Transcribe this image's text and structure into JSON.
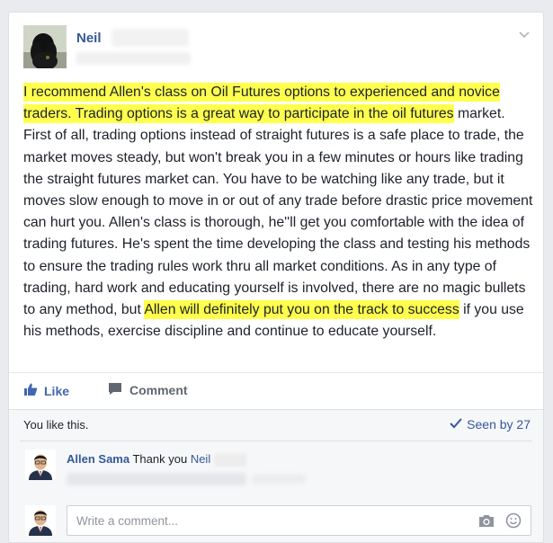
{
  "post": {
    "author_first": "Neil",
    "text_before": "I recommend Allen's class on Oil Futures options to experienced and novice traders. Trading options is a great way to participate in the oil futures",
    "text_middle": " market. First of all, trading options instead of straight futures is a safe place to trade, the market moves steady, but won't break you in a few minutes or hours like trading the straight futures market can. You have to be watching like any trade, but it moves slow enough to move in or out of any trade before drastic price movement can hurt you. Allen's class is thorough, he''ll get you comfortable with the idea of trading futures. He's spent the time developing the class and testing his methods to ensure the trading rules work thru all market conditions. As in any type of trading, hard work and educating yourself is involved, there are no magic bullets to any method, but ",
    "text_highlight2": "Allen will definitely put you on the track to success",
    "text_after": " if you use his methods, exercise discipline and continue to educate yourself."
  },
  "actions": {
    "like_label": "Like",
    "comment_label": "Comment"
  },
  "feedback": {
    "likes_text": "You like this.",
    "seen_by": "Seen by 27"
  },
  "comments": [
    {
      "author": "Allen Sama",
      "text": "Thank you",
      "mention": "Neil"
    }
  ],
  "comment_box": {
    "placeholder": "Write a comment..."
  },
  "colors": {
    "link": "#365899",
    "like_blue": "#4267b2",
    "highlight": "#ffff4d"
  },
  "icons": [
    "chevron-down-icon",
    "like-thumb-icon",
    "comment-bubble-icon",
    "checkmark-icon",
    "camera-icon",
    "smiley-icon"
  ]
}
